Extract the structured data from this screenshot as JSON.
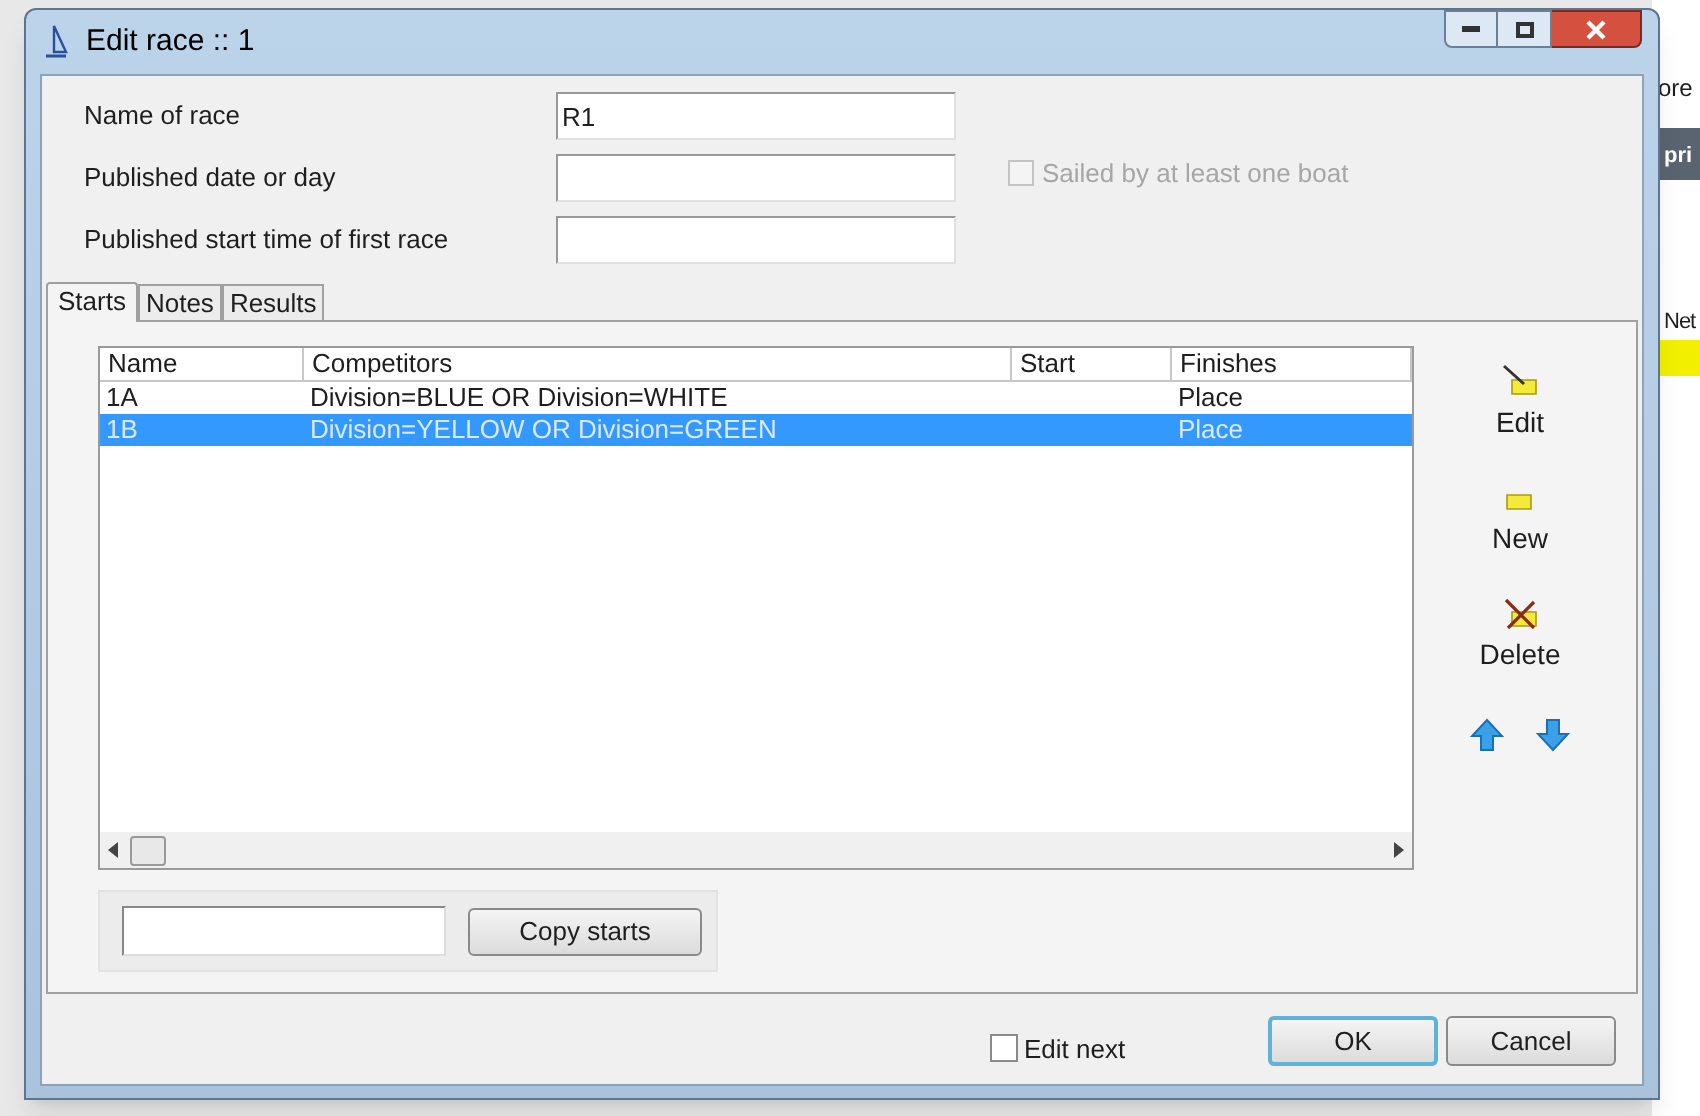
{
  "background": {
    "texts": [
      "ore",
      "pri",
      "Net"
    ]
  },
  "window": {
    "title": "Edit race :: 1"
  },
  "fields": [
    {
      "label": "Name of race",
      "value": "R1"
    },
    {
      "label": "Published date or day"
    },
    {
      "label": "Published start time of first race"
    }
  ],
  "sailed_checkbox": {
    "label": "Sailed by at least one boat",
    "checked": false,
    "disabled": true
  },
  "tabs": [
    {
      "label": "Starts",
      "selected": true
    },
    {
      "label": "Notes",
      "selected": false
    },
    {
      "label": "Results",
      "selected": false
    }
  ],
  "table": {
    "columns": [
      "Name",
      "Competitors",
      "Start",
      "Finishes"
    ],
    "rows": [
      {
        "cells": [
          "1A",
          "Division=BLUE OR Division=WHITE",
          "",
          "Place"
        ],
        "selected": false
      },
      {
        "cells": [
          "1B",
          "Division=YELLOW OR Division=GREEN",
          "",
          "Place"
        ],
        "selected": true
      }
    ]
  },
  "side_buttons": [
    {
      "kind": "edit",
      "label": "Edit"
    },
    {
      "kind": "new",
      "label": "New"
    },
    {
      "kind": "delete",
      "label": "Delete"
    }
  ],
  "copy": {
    "button": "Copy starts"
  },
  "edit_next": {
    "label": "Edit next",
    "checked": false
  },
  "buttons": [
    {
      "label": "OK",
      "default": true
    },
    {
      "label": "Cancel",
      "default": false
    }
  ]
}
